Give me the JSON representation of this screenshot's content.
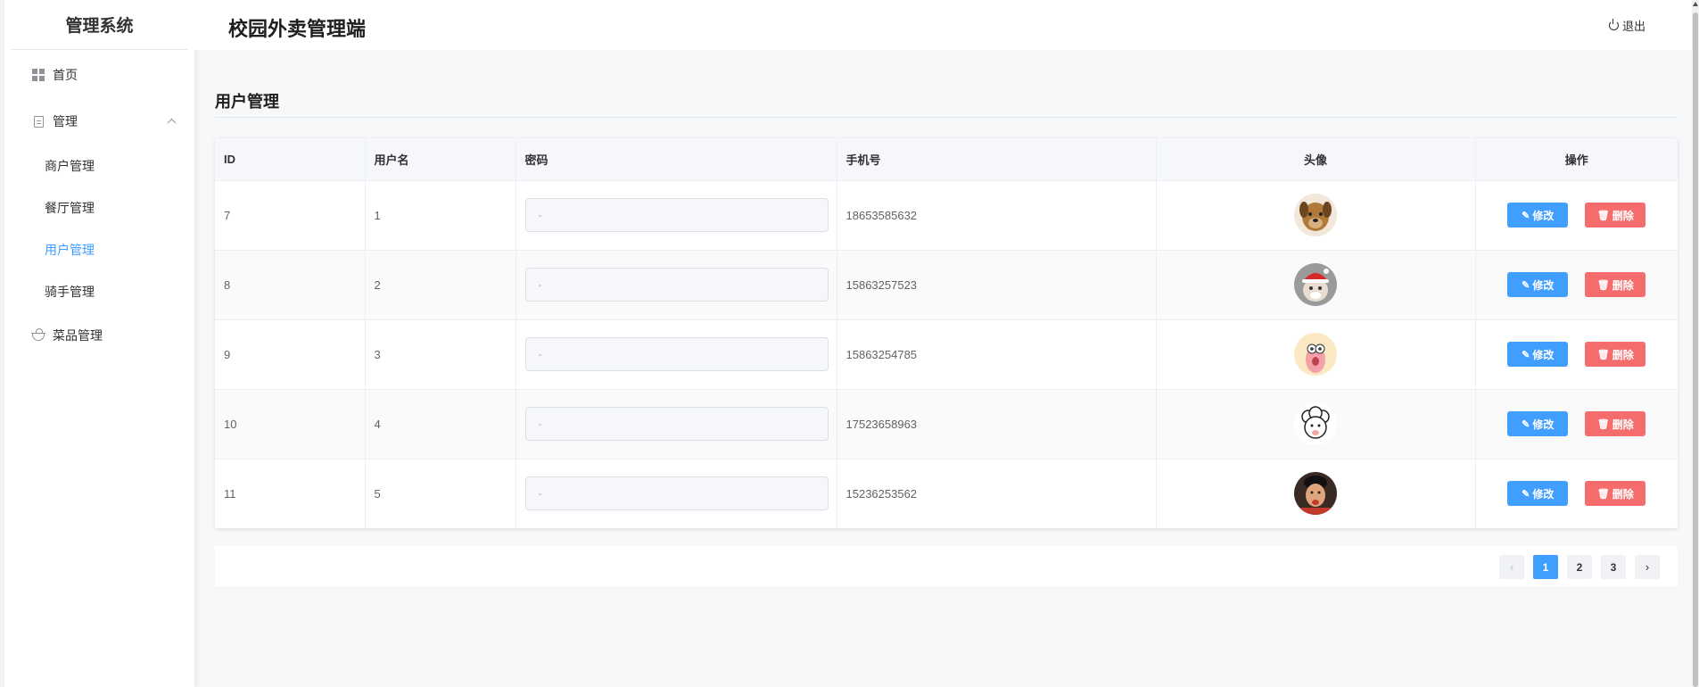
{
  "sidebar": {
    "brand": "管理系统",
    "items": [
      {
        "label": "首页"
      },
      {
        "label": "管理"
      },
      {
        "label": "菜品管理"
      }
    ],
    "sub_items": [
      {
        "label": "商户管理"
      },
      {
        "label": "餐厅管理"
      },
      {
        "label": "用户管理"
      },
      {
        "label": "骑手管理"
      }
    ]
  },
  "header": {
    "title": "校园外卖管理端",
    "logout": "退出"
  },
  "section": {
    "title": "用户管理"
  },
  "table": {
    "columns": [
      "ID",
      "用户名",
      "密码",
      "手机号",
      "头像",
      "操作"
    ],
    "rows": [
      {
        "id": "7",
        "username": "1",
        "password": "-",
        "phone": "18653585632"
      },
      {
        "id": "8",
        "username": "2",
        "password": "-",
        "phone": "15863257523"
      },
      {
        "id": "9",
        "username": "3",
        "password": "-",
        "phone": "15863254785"
      },
      {
        "id": "10",
        "username": "4",
        "password": "-",
        "phone": "17523658963"
      },
      {
        "id": "11",
        "username": "5",
        "password": "-",
        "phone": "15236253562"
      }
    ],
    "edit_label": "修改",
    "delete_label": "删除"
  },
  "pagination": {
    "pages": [
      "1",
      "2",
      "3"
    ],
    "current": "1"
  },
  "colors": {
    "primary": "#409eff",
    "danger": "#f56c6c"
  }
}
